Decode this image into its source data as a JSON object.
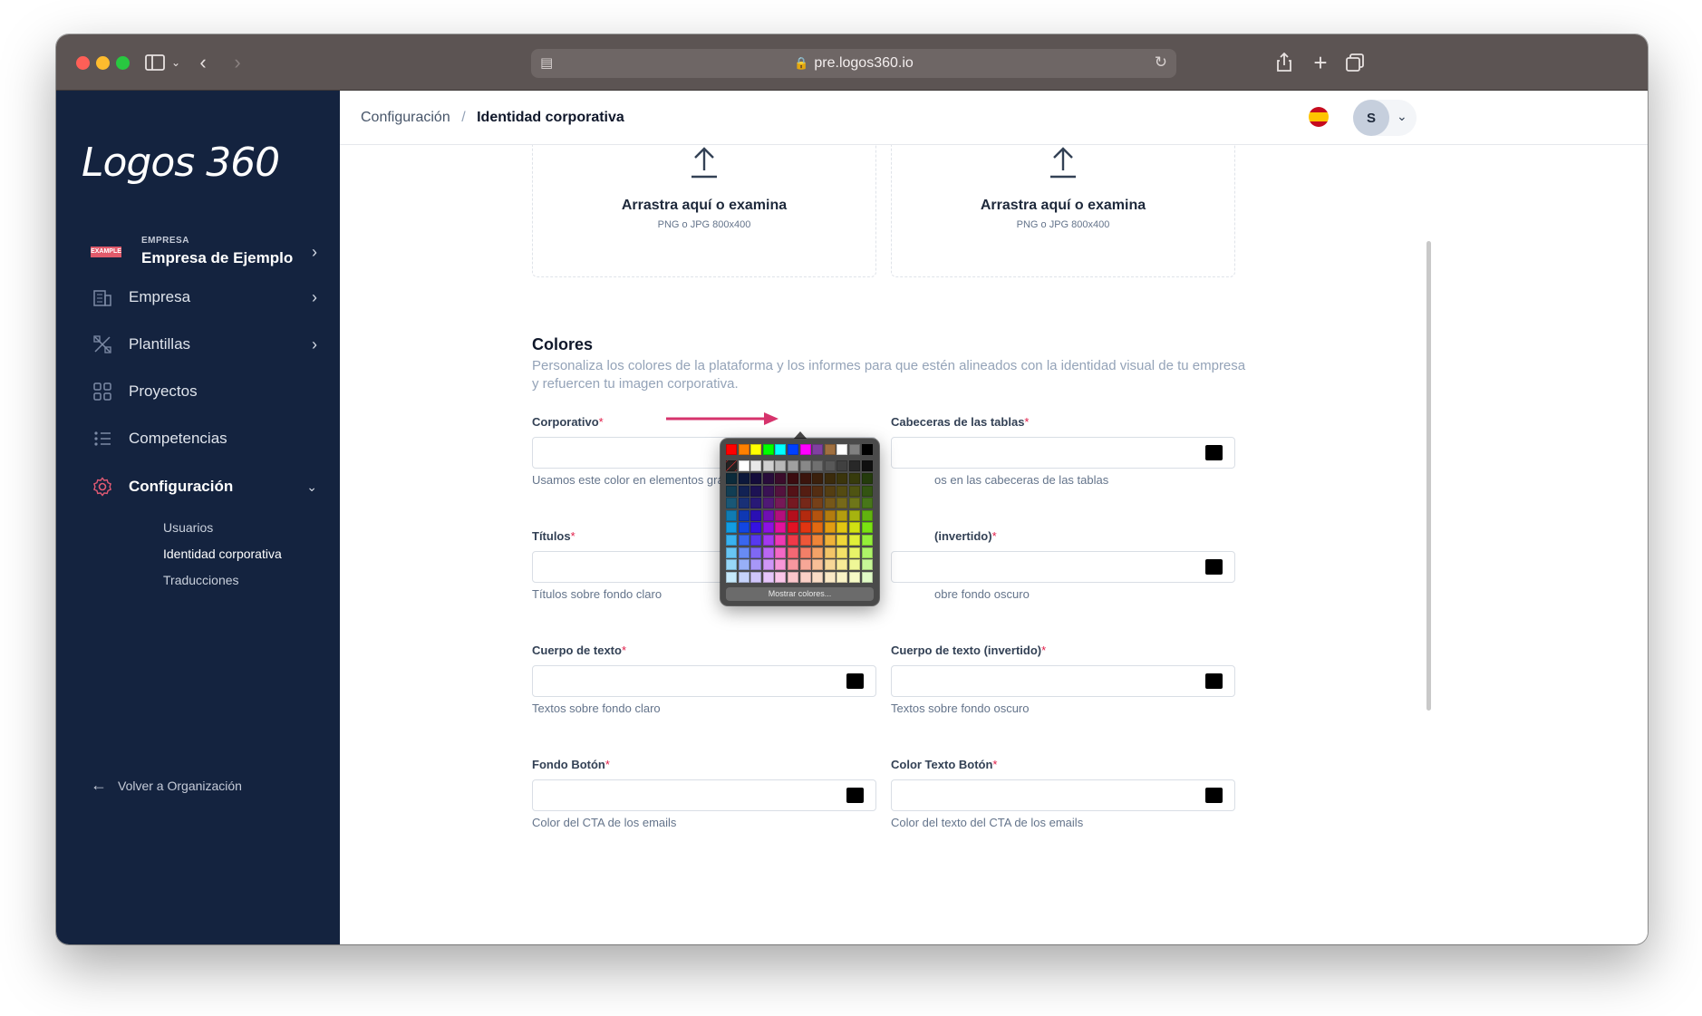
{
  "browser": {
    "url": "pre.logos360.io"
  },
  "sidebar": {
    "logo": "Logos 360",
    "company": {
      "badge": "EXAMPLE",
      "caption": "EMPRESA",
      "name": "Empresa de Ejemplo"
    },
    "items": [
      {
        "label": "Empresa",
        "icon": "building-icon"
      },
      {
        "label": "Plantillas",
        "icon": "templates-icon"
      },
      {
        "label": "Proyectos",
        "icon": "grid-icon"
      },
      {
        "label": "Competencias",
        "icon": "list-icon"
      },
      {
        "label": "Configuración",
        "icon": "gear-icon"
      }
    ],
    "subitems": [
      "Usuarios",
      "Identidad corporativa",
      "Traducciones"
    ],
    "back": "Volver a Organización"
  },
  "header": {
    "breadcrumb": [
      "Configuración",
      "Identidad corporativa"
    ],
    "separator": "/",
    "avatar": "S"
  },
  "dropzones": [
    {
      "title": "Arrastra aquí o examina",
      "hint": "PNG o JPG 800x400"
    },
    {
      "title": "Arrastra aquí o examina",
      "hint": "PNG o JPG 800x400"
    }
  ],
  "colors": {
    "title": "Colores",
    "description": "Personaliza los colores de la plataforma y los informes para que estén alineados con la identidad visual de tu empresa y refuercen tu imagen corporativa.",
    "required_mark": "*",
    "fields": [
      {
        "label": "Corporativo",
        "help": "Usamos este color en elementos gráficos",
        "swatch": "#000000"
      },
      {
        "label": "Cabeceras de las tablas",
        "help": "os en las cabeceras de las tablas",
        "swatch": "#000000"
      },
      {
        "label": "Títulos",
        "help": "Títulos sobre fondo claro",
        "swatch": "#000000"
      },
      {
        "label": "(invertido)",
        "help": "obre fondo oscuro",
        "swatch": "#000000"
      },
      {
        "label": "Cuerpo de texto",
        "help": "Textos sobre fondo claro",
        "swatch": "#000000"
      },
      {
        "label": "Cuerpo de texto (invertido)",
        "help": "Textos sobre fondo oscuro",
        "swatch": "#000000"
      },
      {
        "label": "Fondo Botón",
        "help": "Color del CTA de los emails",
        "swatch": "#000000"
      },
      {
        "label": "Color Texto Botón",
        "help": "Color del texto del CTA de los emails",
        "swatch": "#000000"
      }
    ]
  },
  "picker": {
    "button": "Mostrar colores...",
    "annotation_color": "#d6336c"
  }
}
